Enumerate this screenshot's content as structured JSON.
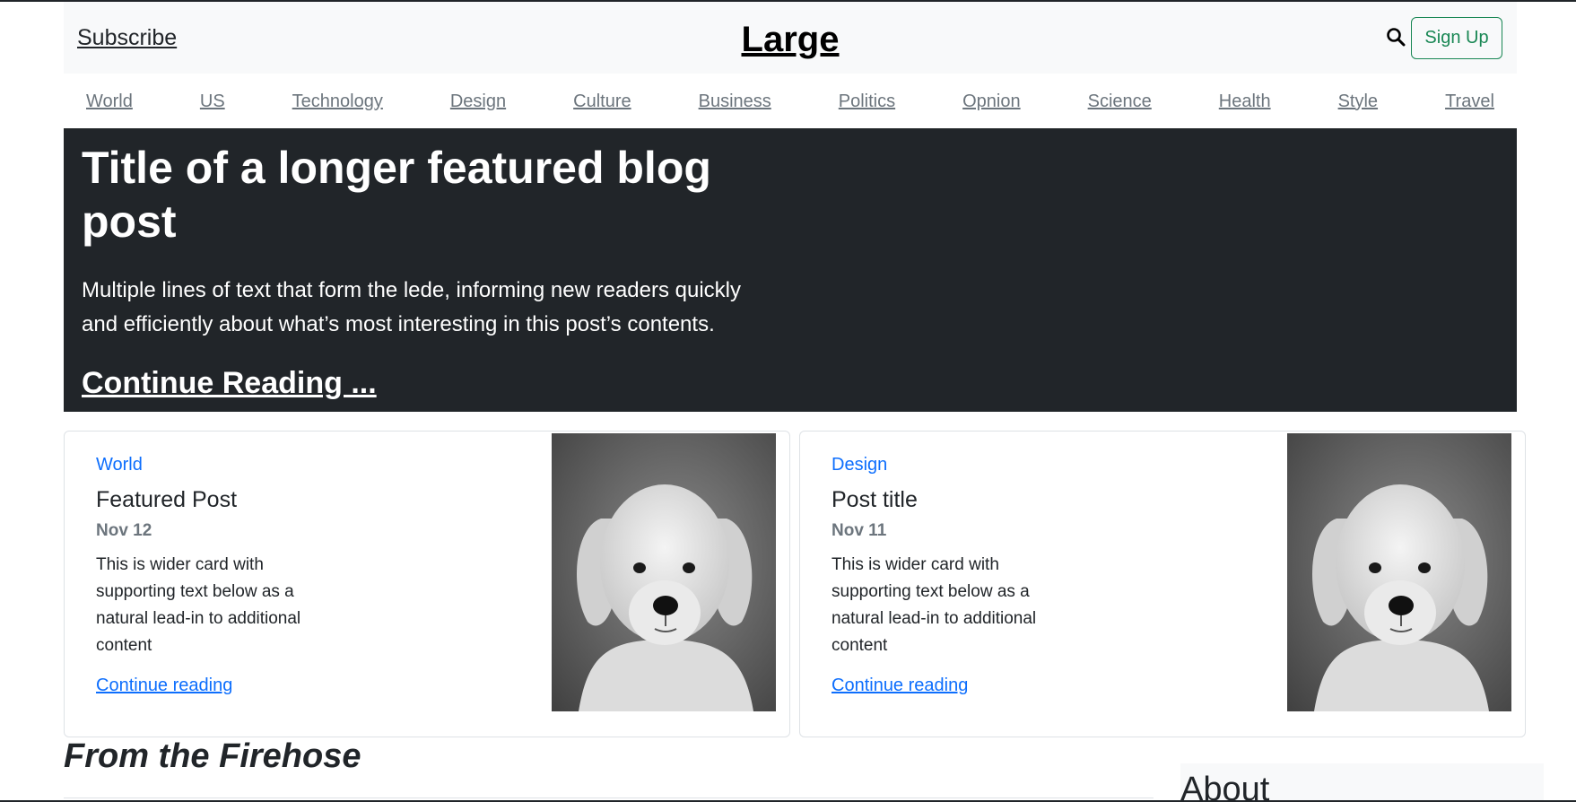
{
  "header": {
    "subscribe": "Subscribe",
    "brand": "Large",
    "search_icon": "search-icon",
    "signup": "Sign Up"
  },
  "nav": [
    "World",
    "US",
    "Technology",
    "Design",
    "Culture",
    "Business",
    "Politics",
    "Opnion",
    "Science",
    "Health",
    "Style",
    "Travel"
  ],
  "hero": {
    "title": "Title of a longer featured blog post",
    "lede": "Multiple lines of text that form the lede, informing new readers quickly and efficiently about what’s most interesting in this post’s contents.",
    "link": "Continue Reading ..."
  },
  "cards": [
    {
      "category": "World",
      "title": "Featured Post",
      "date": "Nov 12",
      "text": "This is wider card with supporting text below as a natural lead-in to additional content",
      "link": "Continue reading"
    },
    {
      "category": "Design",
      "title": "Post title",
      "date": "Nov 11",
      "text": "This is wider card with supporting text below as a natural lead-in to additional content",
      "link": "Continue reading"
    }
  ],
  "sections": {
    "firehose": "From the Firehose",
    "about": "About"
  },
  "colors": {
    "accent": "#0d6efd",
    "success": "#198754",
    "hero_bg": "#212529",
    "muted": "#6c757d"
  }
}
